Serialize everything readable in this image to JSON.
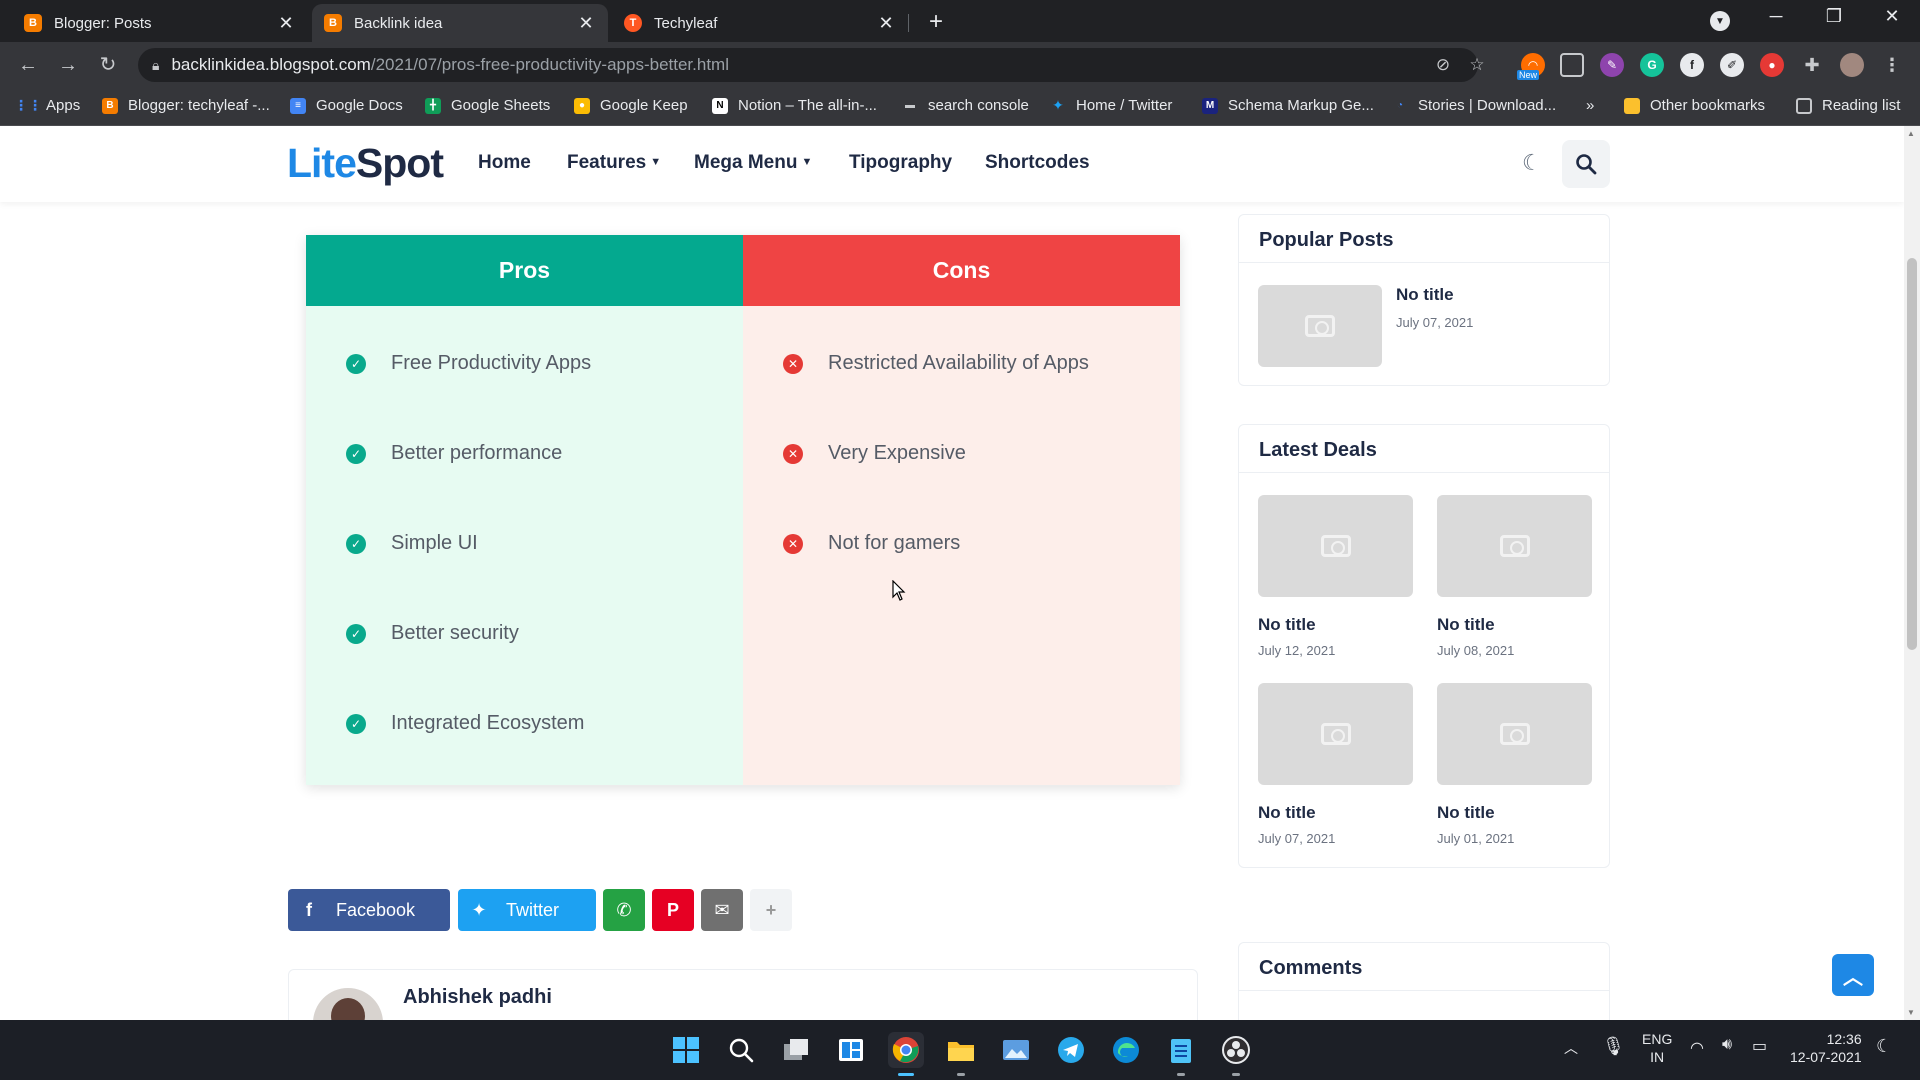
{
  "browser": {
    "tabs": [
      {
        "label": "Blogger: Posts",
        "active": false,
        "favicon": "blogger-icon"
      },
      {
        "label": "Backlink idea",
        "active": true,
        "favicon": "blogger-icon"
      },
      {
        "label": "Techyleaf",
        "active": false,
        "favicon": "techyleaf-icon"
      }
    ],
    "url_host": "backlinkidea.blogspot.com",
    "url_path": "/2021/07/pros-free-productivity-apps-better.html",
    "bookmarks": [
      {
        "label": "Apps",
        "icon": "apps-grid-icon"
      },
      {
        "label": "Blogger: techyleaf -...",
        "icon": "blogger-icon"
      },
      {
        "label": "Google Docs",
        "icon": "docs-icon"
      },
      {
        "label": "Google Sheets",
        "icon": "sheets-icon"
      },
      {
        "label": "Google Keep",
        "icon": "keep-icon"
      },
      {
        "label": "Notion – The all-in-...",
        "icon": "notion-icon"
      },
      {
        "label": "search console",
        "icon": "search-console-icon"
      },
      {
        "label": "Home / Twitter",
        "icon": "twitter-icon"
      },
      {
        "label": "Schema Markup Ge...",
        "icon": "schema-icon"
      },
      {
        "label": "Stories | Download...",
        "icon": "stories-icon"
      }
    ],
    "bookmarks_more": "»",
    "other_bookmarks": "Other bookmarks",
    "reading_list": "Reading list",
    "extension_badge": "New"
  },
  "site": {
    "logo_part1": "Lite",
    "logo_part2": "Spot",
    "nav": [
      {
        "label": "Home",
        "dropdown": false
      },
      {
        "label": "Features",
        "dropdown": true
      },
      {
        "label": "Mega Menu",
        "dropdown": true
      },
      {
        "label": "Tipography",
        "dropdown": false
      },
      {
        "label": "Shortcodes",
        "dropdown": false
      }
    ]
  },
  "proscons": {
    "pros_title": "Pros",
    "cons_title": "Cons",
    "pros": [
      "Free Productivity Apps",
      "Better performance",
      "Simple UI",
      "Better security",
      "Integrated Ecosystem"
    ],
    "cons": [
      "Restricted Availability of Apps",
      "Very Expensive",
      "Not for gamers"
    ],
    "colors": {
      "pros_header": "#04a98f",
      "cons_header": "#ef4444",
      "pros_bg": "#e7fbf2",
      "cons_bg": "#fdeeea"
    }
  },
  "share": {
    "facebook": "Facebook",
    "twitter": "Twitter",
    "colors": {
      "facebook": "#3b5998",
      "twitter": "#1da1f2",
      "whatsapp": "#25a244",
      "pinterest": "#e60023",
      "email": "#707070"
    }
  },
  "author": {
    "name": "Abhishek padhi"
  },
  "sidebar": {
    "popular_title": "Popular Posts",
    "popular": [
      {
        "title": "No title",
        "date": "July 07, 2021"
      }
    ],
    "deals_title": "Latest Deals",
    "deals": [
      {
        "title": "No title",
        "date": "July 12, 2021"
      },
      {
        "title": "No title",
        "date": "July 08, 2021"
      },
      {
        "title": "No title",
        "date": "July 07, 2021"
      },
      {
        "title": "No title",
        "date": "July 01, 2021"
      }
    ],
    "comments_title": "Comments"
  },
  "taskbar": {
    "lang_top": "ENG",
    "lang_bottom": "IN",
    "time": "12:36",
    "date": "12-07-2021"
  }
}
